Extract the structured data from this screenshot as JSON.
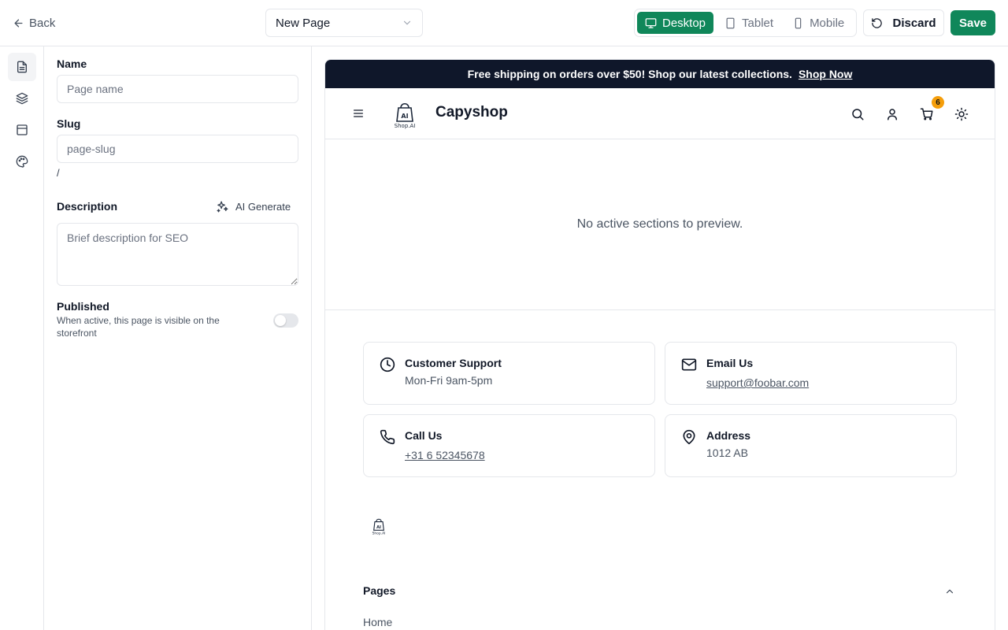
{
  "topbar": {
    "back_label": "Back",
    "page_select_value": "New Page",
    "devices": [
      {
        "label": "Desktop",
        "icon": "monitor-icon",
        "active": true
      },
      {
        "label": "Tablet",
        "icon": "tablet-icon",
        "active": false
      },
      {
        "label": "Mobile",
        "icon": "smartphone-icon",
        "active": false
      }
    ],
    "discard_label": "Discard",
    "save_label": "Save"
  },
  "rail": {
    "items": [
      {
        "icon": "file-text-icon",
        "active": true
      },
      {
        "icon": "layers-icon",
        "active": false
      },
      {
        "icon": "layout-icon",
        "active": false
      },
      {
        "icon": "palette-icon",
        "active": false
      }
    ]
  },
  "panel": {
    "name_label": "Name",
    "name_placeholder": "Page name",
    "slug_label": "Slug",
    "slug_placeholder": "page-slug",
    "slug_prefix": "/",
    "description_label": "Description",
    "ai_generate_label": "AI Generate",
    "description_placeholder": "Brief description for SEO",
    "published_label": "Published",
    "published_help": "When active, this page is visible on the storefront",
    "published": false
  },
  "preview": {
    "announcement_text": "Free shipping on orders over $50! Shop our latest collections.",
    "announcement_link": "Shop Now",
    "logo_text": "Shop.AI",
    "brand_name": "Capyshop",
    "cart_count": "6",
    "empty_message": "No active sections to preview.",
    "contact_cards": [
      {
        "icon": "clock-icon",
        "title": "Customer Support",
        "value": "Mon-Fri 9am-5pm",
        "link": false
      },
      {
        "icon": "mail-icon",
        "title": "Email Us",
        "value": "support@foobar.com",
        "link": true
      },
      {
        "icon": "phone-icon",
        "title": "Call Us",
        "value": "+31 6 52345678",
        "link": true
      },
      {
        "icon": "map-pin-icon",
        "title": "Address",
        "value": "1012 AB",
        "link": false
      }
    ],
    "footer_pages_title": "Pages",
    "footer_pages": [
      "Home"
    ]
  },
  "colors": {
    "accent": "#10875a",
    "announcement_bg": "#0f172a",
    "badge": "#f59e0b",
    "border": "#e5e7eb"
  }
}
